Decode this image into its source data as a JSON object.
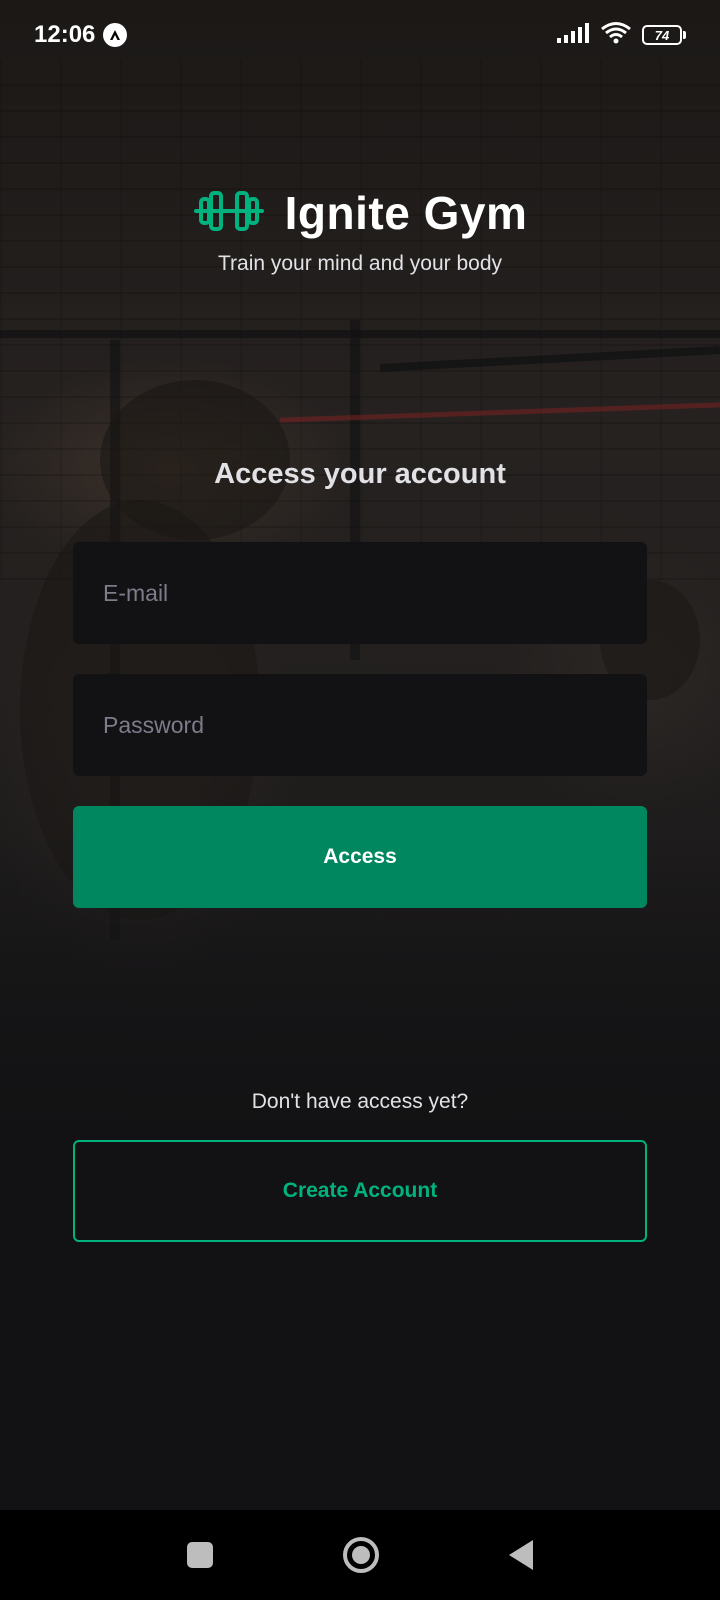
{
  "status_bar": {
    "time": "12:06",
    "battery": "74",
    "icons": [
      "app-notification-icon",
      "signal-icon",
      "wifi-icon",
      "battery-icon"
    ]
  },
  "brand": {
    "title": "Ignite Gym",
    "tagline": "Train your mind and your body",
    "logo_icon": "dumbbell-icon",
    "accent_color": "#00B37E"
  },
  "form": {
    "heading": "Access your account",
    "email_placeholder": "E-mail",
    "email_value": "",
    "password_placeholder": "Password",
    "password_value": "",
    "submit_label": "Access",
    "submit_color": "#00875F"
  },
  "signup": {
    "prompt": "Don't have access yet?",
    "button_label": "Create Account"
  },
  "nav_bar": {
    "icons": [
      "recents-icon",
      "home-icon",
      "back-icon"
    ]
  }
}
